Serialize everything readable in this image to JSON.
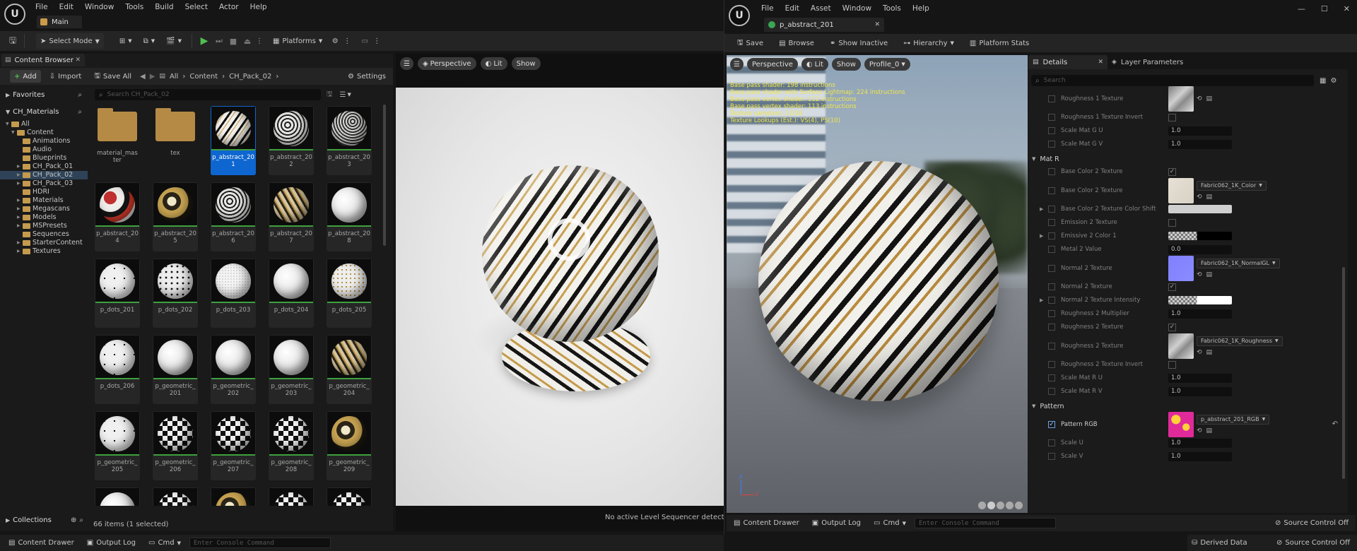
{
  "left_editor": {
    "menu": [
      "File",
      "Edit",
      "Window",
      "Tools",
      "Build",
      "Select",
      "Actor",
      "Help"
    ],
    "level_tab": "Main",
    "toolbar": {
      "select_mode": "Select Mode",
      "platforms": "Platforms"
    },
    "content_browser": {
      "tab_title": "Content Browser",
      "add_label": "Add",
      "import_label": "Import",
      "save_all_label": "Save All",
      "breadcrumb": [
        "All",
        "Content",
        "CH_Pack_02"
      ],
      "settings_label": "Settings",
      "search_placeholder": "Search CH_Pack_02",
      "favorites_label": "Favorites",
      "collection_root": "CH_Materials",
      "tree": [
        {
          "label": "All",
          "indent": 0
        },
        {
          "label": "Content",
          "indent": 1
        },
        {
          "label": "Animations",
          "indent": 2
        },
        {
          "label": "Audio",
          "indent": 2
        },
        {
          "label": "Blueprints",
          "indent": 2
        },
        {
          "label": "CH_Pack_01",
          "indent": 2
        },
        {
          "label": "CH_Pack_02",
          "indent": 2,
          "selected": true
        },
        {
          "label": "CH_Pack_03",
          "indent": 2
        },
        {
          "label": "HDRI",
          "indent": 2
        },
        {
          "label": "Materials",
          "indent": 2
        },
        {
          "label": "Megascans",
          "indent": 2
        },
        {
          "label": "Models",
          "indent": 2
        },
        {
          "label": "MSPresets",
          "indent": 2
        },
        {
          "label": "Sequences",
          "indent": 2
        },
        {
          "label": "StarterContent",
          "indent": 2
        },
        {
          "label": "Textures",
          "indent": 2
        }
      ],
      "assets": [
        {
          "label": "material_master",
          "kind": "folder"
        },
        {
          "label": "tex",
          "kind": "folder"
        },
        {
          "label": "p_abstract_201",
          "kind": "material",
          "selected": true,
          "style": "stripe"
        },
        {
          "label": "p_abstract_202",
          "kind": "material",
          "style": "swirl"
        },
        {
          "label": "p_abstract_203",
          "kind": "material",
          "style": "swirl2"
        },
        {
          "label": "p_abstract_204",
          "kind": "material",
          "style": "red"
        },
        {
          "label": "p_abstract_205",
          "kind": "material",
          "style": "gold"
        },
        {
          "label": "p_abstract_206",
          "kind": "material",
          "style": "swirl"
        },
        {
          "label": "p_abstract_207",
          "kind": "material",
          "style": "gold2"
        },
        {
          "label": "p_abstract_208",
          "kind": "material",
          "style": "white"
        },
        {
          "label": "p_dots_201",
          "kind": "material",
          "style": "dots"
        },
        {
          "label": "p_dots_202",
          "kind": "material",
          "style": "dotsdense"
        },
        {
          "label": "p_dots_203",
          "kind": "material",
          "style": "dotsfine"
        },
        {
          "label": "p_dots_204",
          "kind": "material",
          "style": "white"
        },
        {
          "label": "p_dots_205",
          "kind": "material",
          "style": "dotsgold"
        },
        {
          "label": "p_dots_206",
          "kind": "material",
          "style": "dots"
        },
        {
          "label": "p_geometric_201",
          "kind": "material",
          "style": "white"
        },
        {
          "label": "p_geometric_202",
          "kind": "material",
          "style": "white"
        },
        {
          "label": "p_geometric_203",
          "kind": "material",
          "style": "white"
        },
        {
          "label": "p_geometric_204",
          "kind": "material",
          "style": "gold2"
        },
        {
          "label": "p_geometric_205",
          "kind": "material",
          "style": "dots"
        },
        {
          "label": "p_geometric_206",
          "kind": "material",
          "style": "checker"
        },
        {
          "label": "p_geometric_207",
          "kind": "material",
          "style": "checker"
        },
        {
          "label": "p_geometric_208",
          "kind": "material",
          "style": "checker"
        },
        {
          "label": "p_geometric_209",
          "kind": "material",
          "style": "gold"
        },
        {
          "label": "",
          "kind": "material",
          "style": "white"
        },
        {
          "label": "",
          "kind": "material",
          "style": "checker"
        },
        {
          "label": "",
          "kind": "material",
          "style": "gold"
        },
        {
          "label": "",
          "kind": "material",
          "style": "checker"
        },
        {
          "label": "",
          "kind": "material",
          "style": "checker"
        }
      ],
      "collections_label": "Collections",
      "status": "66 items (1 selected)"
    },
    "viewport": {
      "perspective": "Perspective",
      "lit": "Lit",
      "show": "Show",
      "sequencer_msg": "No active Level Sequencer detected. Pl"
    },
    "bottom": {
      "content_drawer": "Content Drawer",
      "output_log": "Output Log",
      "cmd": "Cmd",
      "console_placeholder": "Enter Console Command"
    }
  },
  "material_editor": {
    "menu": [
      "File",
      "Edit",
      "Asset",
      "Window",
      "Tools",
      "Help"
    ],
    "asset_tab": "p_abstract_201",
    "toolbar": {
      "save": "Save",
      "browse": "Browse",
      "show_inactive": "Show Inactive",
      "hierarchy": "Hierarchy",
      "platform_stats": "Platform Stats"
    },
    "viewport": {
      "perspective": "Perspective",
      "lit": "Lit",
      "show": "Show",
      "profile": "Profile_0",
      "stats": [
        "Base pass shader: 198 instructions",
        "Base pass shader with Surface Lightmap: 224 instructions",
        "Base pass vertex shader: 112 instructions",
        "Base pass vertex shader: 113 instructions",
        "Texture samplers: 13/16",
        "Texture Lookups (Est.): VS(4), PS(10)"
      ]
    },
    "details": {
      "tab": "Details",
      "layer_tab": "Layer Parameters",
      "search_placeholder": "Search",
      "rows_top": [
        {
          "name": "Roughness 1 Texture",
          "type": "texture",
          "tex": "rough"
        },
        {
          "name": "Roughness 1 Texture Invert",
          "type": "check",
          "checked": false
        },
        {
          "name": "Scale Mat G U",
          "type": "num",
          "value": "1.0"
        },
        {
          "name": "Scale Mat G V",
          "type": "num",
          "value": "1.0"
        }
      ],
      "section_mat_r": "Mat R",
      "rows_mat_r": [
        {
          "name": "Base Color 2 Texture",
          "type": "check",
          "checked": true
        },
        {
          "name": "Base Color 2 Texture",
          "type": "texture",
          "tex": "color",
          "asset": "Fabric062_1K_Color"
        },
        {
          "name": "Base Color 2 Texture Color Shift",
          "type": "swatch",
          "color": "#cfcfcf",
          "expand": true
        },
        {
          "name": "Emission 2 Texture",
          "type": "check",
          "checked": false
        },
        {
          "name": "Emissive 2 Color 1",
          "type": "emissive",
          "expand": true
        },
        {
          "name": "Metal 2 Value",
          "type": "num",
          "value": "0.0"
        },
        {
          "name": "Normal 2 Texture",
          "type": "texture",
          "tex": "normal",
          "asset": "Fabric062_1K_NormalGL"
        },
        {
          "name": "Normal 2 Texture",
          "type": "check",
          "checked": true
        },
        {
          "name": "Normal 2 Texture Intensity",
          "type": "intensity",
          "expand": true
        },
        {
          "name": "Roughness 2 Multiplier",
          "type": "num",
          "value": "1.0"
        },
        {
          "name": "Roughness 2 Texture",
          "type": "check",
          "checked": true
        },
        {
          "name": "Roughness 2 Texture",
          "type": "texture",
          "tex": "rough",
          "asset": "Fabric062_1K_Roughness"
        },
        {
          "name": "Roughness 2 Texture Invert",
          "type": "check",
          "checked": false
        },
        {
          "name": "Scale Mat R U",
          "type": "num",
          "value": "1.0"
        },
        {
          "name": "Scale Mat R V",
          "type": "num",
          "value": "1.0"
        }
      ],
      "section_pattern": "Pattern",
      "rows_pattern": [
        {
          "name": "Pattern RGB",
          "type": "texture",
          "tex": "pattern",
          "asset": "p_abstract_201_RGB",
          "checkedBox": true
        },
        {
          "name": "Scale U",
          "type": "num",
          "value": "1.0"
        },
        {
          "name": "Scale V",
          "type": "num",
          "value": "1.0"
        }
      ]
    },
    "bottom": {
      "content_drawer": "Content Drawer",
      "output_log": "Output Log",
      "cmd": "Cmd",
      "console_placeholder": "Enter Console Command",
      "source_control": "Source Control Off"
    }
  },
  "status_bar": {
    "derived_data": "Derived Data",
    "source_control": "Source Control Off"
  }
}
